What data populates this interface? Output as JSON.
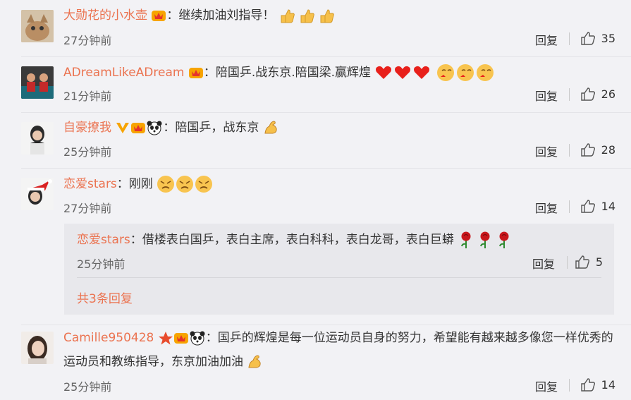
{
  "comments": [
    {
      "user": "大勋花的小水壶",
      "text": "：继续加油刘指导！",
      "time": "27分钟前",
      "reply": "回复",
      "likes": "35",
      "icons": [
        "vip-crown-icon",
        "thumbs-up-emoji"
      ]
    },
    {
      "user": "ADreamLikeADream",
      "text": "：陪国乒.战东京.陪国梁.赢辉煌",
      "time": "21分钟前",
      "reply": "回复",
      "likes": "26",
      "icons": [
        "vip-crown-icon",
        "red-heart-emoji",
        "kiss-face-emoji"
      ]
    },
    {
      "user": "自豪撩我",
      "text": "：陪国乒，战东京",
      "time": "25分钟前",
      "reply": "回复",
      "likes": "28",
      "icons": [
        "verified-v-icon",
        "vip-crown-icon",
        "panda-icon",
        "flexed-arm-emoji"
      ]
    },
    {
      "user": "恋爱stars",
      "text": "：刚刚",
      "time": "27分钟前",
      "reply": "回复",
      "likes": "14",
      "icons": [
        "crying-face-emoji"
      ],
      "subreply": {
        "user": "恋爱stars",
        "text": "：借楼表白国乒，表白主席，表白科科，表白龙哥，表白巨蟒",
        "time": "25分钟前",
        "reply": "回复",
        "likes": "5",
        "more": "共3条回复",
        "icons": [
          "rose-emoji"
        ]
      }
    },
    {
      "user": "Camille950428",
      "text": "：国乒的辉煌是每一位运动员自身的努力，希望能有越来越多像您一样优秀的运动员和教练指导，东京加油加油",
      "time": "25分钟前",
      "reply": "回复",
      "likes": "14",
      "icons": [
        "star-icon",
        "vip-crown-icon",
        "panda-icon",
        "flexed-arm-emoji"
      ]
    }
  ],
  "colors": {
    "username": "#eb7350",
    "background": "#f2f2f5",
    "subreply_bg": "#e8e8ec"
  }
}
